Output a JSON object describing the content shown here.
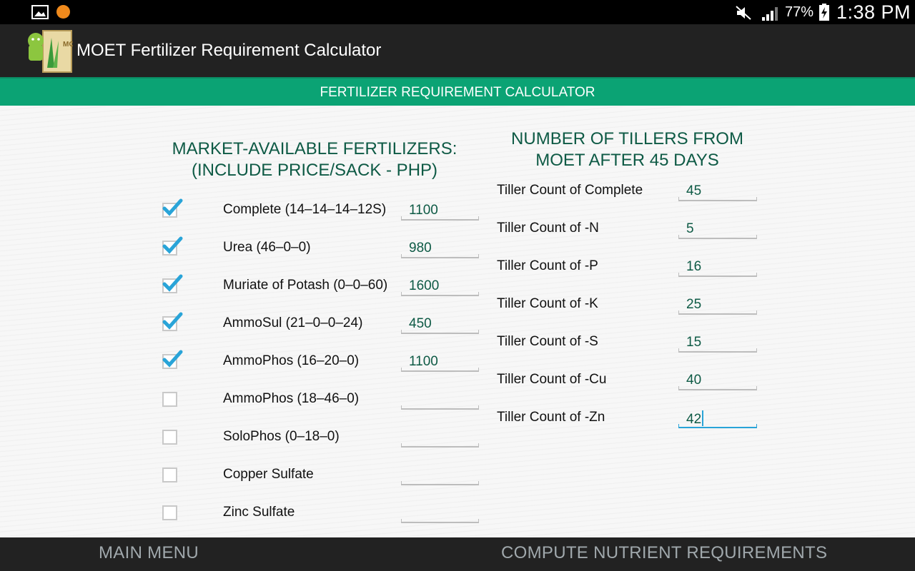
{
  "status_bar": {
    "battery_percent": "77%",
    "time": "1:38 PM",
    "icons": [
      "gallery-icon",
      "notification-icon",
      "mute-icon",
      "signal-icon",
      "battery-charging-icon"
    ]
  },
  "app": {
    "title": "MOET Fertilizer Requirement Calculator",
    "logo_text": "MOET"
  },
  "banner": {
    "title": "FERTILIZER REQUIREMENT CALCULATOR"
  },
  "left_section": {
    "heading_line1": "MARKET-AVAILABLE FERTILIZERS:",
    "heading_line2": "(INCLUDE PRICE/SACK - PHP)",
    "fertilizers": [
      {
        "label": "Complete (14–14–14–12S)",
        "checked": true,
        "price": "1100"
      },
      {
        "label": "Urea (46–0–0)",
        "checked": true,
        "price": "980"
      },
      {
        "label": "Muriate of Potash (0–0–60)",
        "checked": true,
        "price": "1600"
      },
      {
        "label": "AmmoSul (21–0–0–24)",
        "checked": true,
        "price": "450"
      },
      {
        "label": "AmmoPhos (16–20–0)",
        "checked": true,
        "price": "1100"
      },
      {
        "label": "AmmoPhos (18–46–0)",
        "checked": false,
        "price": ""
      },
      {
        "label": "SoloPhos (0–18–0)",
        "checked": false,
        "price": ""
      },
      {
        "label": "Copper Sulfate",
        "checked": false,
        "price": ""
      },
      {
        "label": "Zinc Sulfate",
        "checked": false,
        "price": ""
      }
    ]
  },
  "right_section": {
    "heading_line1": "NUMBER OF TILLERS FROM",
    "heading_line2": "MOET AFTER 45 DAYS",
    "tillers": [
      {
        "label": "Tiller Count of Complete",
        "value": "45"
      },
      {
        "label": "Tiller Count of -N",
        "value": "5"
      },
      {
        "label": "Tiller Count of -P",
        "value": "16"
      },
      {
        "label": "Tiller Count of -K",
        "value": "25"
      },
      {
        "label": "Tiller Count of -S",
        "value": "15"
      },
      {
        "label": "Tiller Count of -Cu",
        "value": "40"
      },
      {
        "label": "Tiller Count of -Zn",
        "value": "42"
      }
    ]
  },
  "bottom_bar": {
    "main_menu": "MAIN MENU",
    "compute": "COMPUTE NUTRIENT REQUIREMENTS"
  },
  "colors": {
    "accent_green": "#0ba374",
    "heading_green": "#0e5a45",
    "checkbox_blue": "#29a4d8",
    "bar_dark": "#222222"
  }
}
